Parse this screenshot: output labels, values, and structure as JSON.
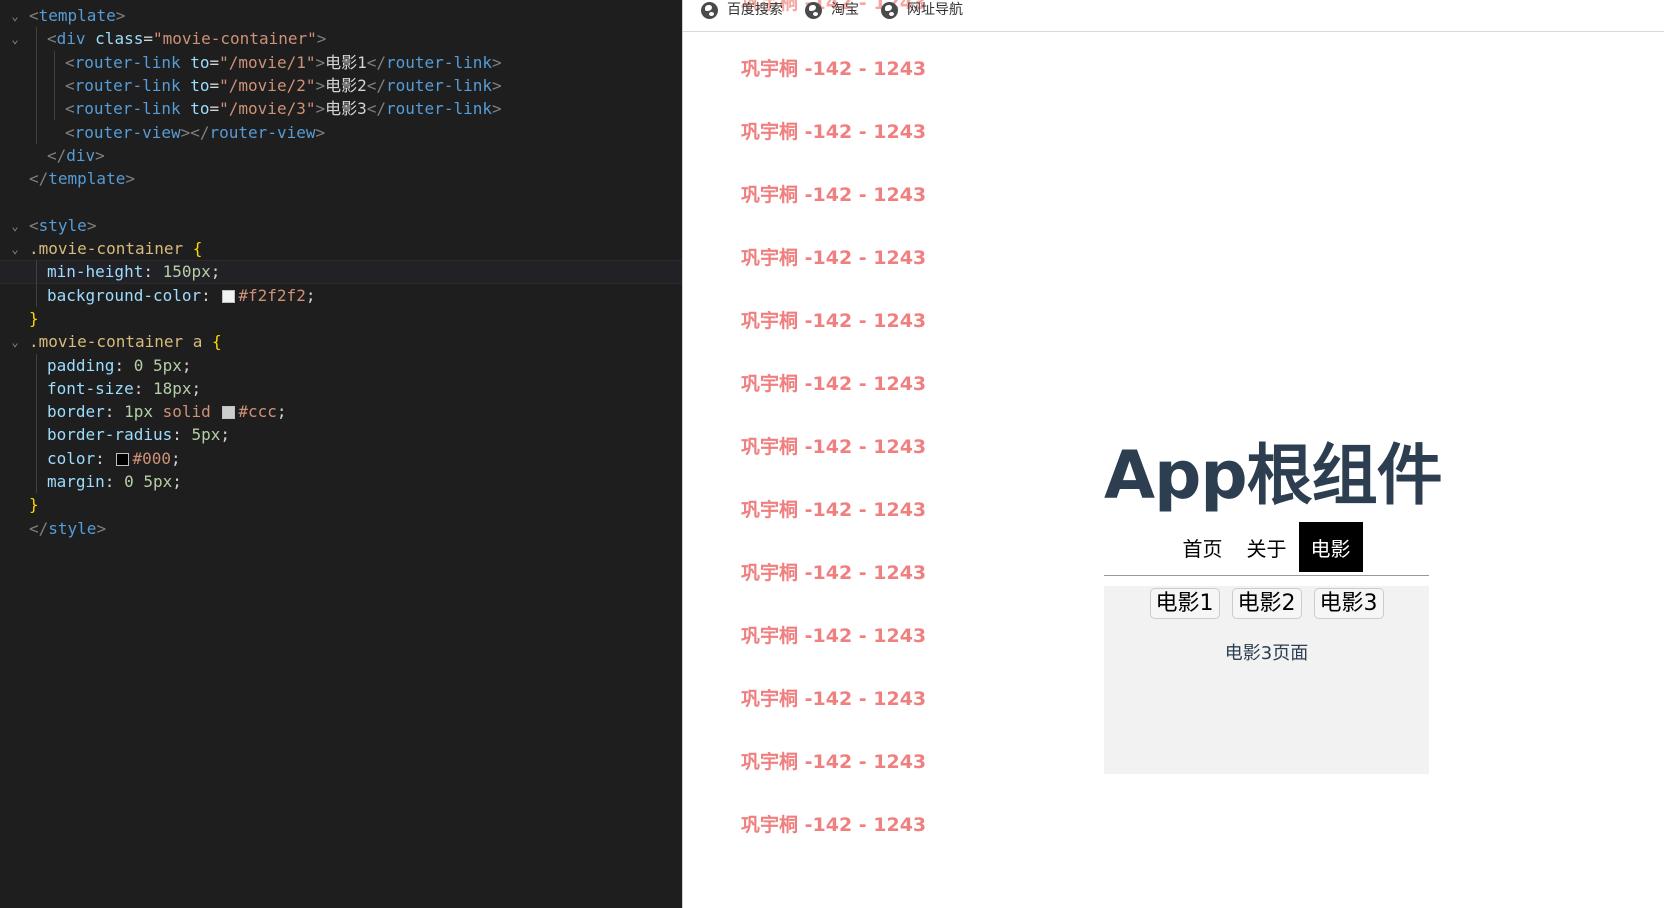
{
  "editor": {
    "lines": [
      [
        [
          "t-punc",
          "<"
        ],
        [
          "t-tag",
          "template"
        ],
        [
          "t-punc",
          ">"
        ]
      ],
      [
        [
          "t-punc",
          "<"
        ],
        [
          "t-tag",
          "div "
        ],
        [
          "t-attr",
          "class"
        ],
        [
          "t-txt",
          "="
        ],
        [
          "t-str",
          "\"movie-container\""
        ],
        [
          "t-punc",
          ">"
        ]
      ],
      [
        [
          "t-punc",
          "<"
        ],
        [
          "t-tag",
          "router-link "
        ],
        [
          "t-attr",
          "to"
        ],
        [
          "t-txt",
          "="
        ],
        [
          "t-str",
          "\"/movie/1\""
        ],
        [
          "t-punc",
          ">"
        ],
        [
          "t-txt",
          "电影1"
        ],
        [
          "t-punc",
          "</"
        ],
        [
          "t-tag",
          "router-link"
        ],
        [
          "t-punc",
          ">"
        ]
      ],
      [
        [
          "t-punc",
          "<"
        ],
        [
          "t-tag",
          "router-link "
        ],
        [
          "t-attr",
          "to"
        ],
        [
          "t-txt",
          "="
        ],
        [
          "t-str",
          "\"/movie/2\""
        ],
        [
          "t-punc",
          ">"
        ],
        [
          "t-txt",
          "电影2"
        ],
        [
          "t-punc",
          "</"
        ],
        [
          "t-tag",
          "router-link"
        ],
        [
          "t-punc",
          ">"
        ]
      ],
      [
        [
          "t-punc",
          "<"
        ],
        [
          "t-tag",
          "router-link "
        ],
        [
          "t-attr",
          "to"
        ],
        [
          "t-txt",
          "="
        ],
        [
          "t-str",
          "\"/movie/3\""
        ],
        [
          "t-punc",
          ">"
        ],
        [
          "t-txt",
          "电影3"
        ],
        [
          "t-punc",
          "</"
        ],
        [
          "t-tag",
          "router-link"
        ],
        [
          "t-punc",
          ">"
        ]
      ],
      [
        [
          "t-punc",
          "<"
        ],
        [
          "t-tag",
          "router-view"
        ],
        [
          "t-punc",
          "></"
        ],
        [
          "t-tag",
          "router-view"
        ],
        [
          "t-punc",
          ">"
        ]
      ],
      [
        [
          "t-punc",
          "</"
        ],
        [
          "t-tag",
          "div"
        ],
        [
          "t-punc",
          ">"
        ]
      ],
      [
        [
          "t-punc",
          "</"
        ],
        [
          "t-tag",
          "template"
        ],
        [
          "t-punc",
          ">"
        ]
      ],
      [],
      [
        [
          "t-punc",
          "<"
        ],
        [
          "t-tag",
          "style"
        ],
        [
          "t-punc",
          ">"
        ]
      ],
      [
        [
          "t-sel",
          ".movie-container "
        ],
        [
          "t-brace",
          "{"
        ]
      ],
      [
        [
          "t-prop",
          "min-height"
        ],
        [
          "t-txt",
          ": "
        ],
        [
          "t-num",
          "150px"
        ],
        [
          "t-txt",
          ";"
        ]
      ],
      [
        [
          "t-prop",
          "background-color"
        ],
        [
          "t-txt",
          ": "
        ],
        [
          "sw",
          "#f2f2f2"
        ],
        [
          "t-val",
          "#f2f2f2"
        ],
        [
          "t-txt",
          ";"
        ]
      ],
      [
        [
          "t-brace",
          "}"
        ]
      ],
      [
        [
          "t-sel",
          ".movie-container a "
        ],
        [
          "t-brace",
          "{"
        ]
      ],
      [
        [
          "t-prop",
          "padding"
        ],
        [
          "t-txt",
          ": "
        ],
        [
          "t-num",
          "0 5px"
        ],
        [
          "t-txt",
          ";"
        ]
      ],
      [
        [
          "t-prop",
          "font-size"
        ],
        [
          "t-txt",
          ": "
        ],
        [
          "t-num",
          "18px"
        ],
        [
          "t-txt",
          ";"
        ]
      ],
      [
        [
          "t-prop",
          "border"
        ],
        [
          "t-txt",
          ": "
        ],
        [
          "t-num",
          "1px "
        ],
        [
          "t-kw",
          "solid "
        ],
        [
          "sw",
          "#cccccc"
        ],
        [
          "t-val",
          "#ccc"
        ],
        [
          "t-txt",
          ";"
        ]
      ],
      [
        [
          "t-prop",
          "border-radius"
        ],
        [
          "t-txt",
          ": "
        ],
        [
          "t-num",
          "5px"
        ],
        [
          "t-txt",
          ";"
        ]
      ],
      [
        [
          "t-prop",
          "color"
        ],
        [
          "t-txt",
          ": "
        ],
        [
          "sw",
          "#000000"
        ],
        [
          "t-val",
          "#000"
        ],
        [
          "t-txt",
          ";"
        ]
      ],
      [
        [
          "t-prop",
          "margin"
        ],
        [
          "t-txt",
          ": "
        ],
        [
          "t-num",
          "0 5px"
        ],
        [
          "t-txt",
          ";"
        ]
      ],
      [
        [
          "t-brace",
          "}"
        ]
      ],
      [
        [
          "t-punc",
          "</"
        ],
        [
          "t-tag",
          "style"
        ],
        [
          "t-punc",
          ">"
        ]
      ]
    ]
  },
  "browser": {
    "bookmarks": [
      "百度搜索",
      "淘宝",
      "网址导航"
    ],
    "watermark": "巩宇桐 -142 - 1243",
    "app": {
      "title": "App根组件",
      "nav": [
        "首页",
        "关于",
        "电影"
      ],
      "active_nav": "电影",
      "movie_links": [
        "电影1",
        "电影2",
        "电影3"
      ],
      "page_text": "电影3页面"
    }
  }
}
